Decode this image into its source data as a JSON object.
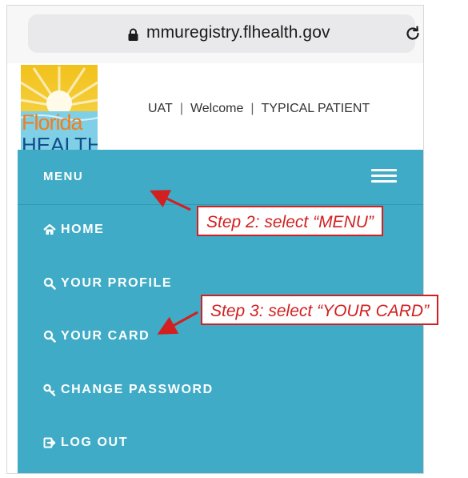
{
  "browser": {
    "url": "mmuregistry.flhealth.gov",
    "lock_icon": "lock-icon",
    "reload_icon": "reload-icon"
  },
  "logo": {
    "line1": "Florida",
    "line2": "HEALTH"
  },
  "topnav": {
    "env": "UAT",
    "welcome": "Welcome",
    "user": "TYPICAL PATIENT"
  },
  "menu": {
    "title": "MENU",
    "items": [
      {
        "label": "HOME",
        "icon": "home-icon"
      },
      {
        "label": "YOUR PROFILE",
        "icon": "search-icon"
      },
      {
        "label": "YOUR CARD",
        "icon": "search-icon"
      },
      {
        "label": "CHANGE PASSWORD",
        "icon": "key-icon"
      },
      {
        "label": "LOG OUT",
        "icon": "logout-icon"
      }
    ]
  },
  "annotations": {
    "step2": "Step 2: select “MENU”",
    "step3": "Step 3: select “YOUR CARD”"
  },
  "colors": {
    "menu_bg": "#3fabc6",
    "annotation_red": "#d21f1f"
  }
}
